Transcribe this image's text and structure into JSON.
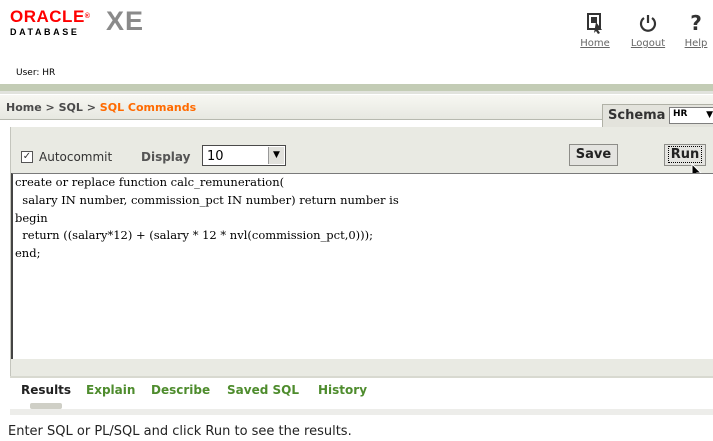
{
  "header": {
    "logo_oracle": "ORACLE",
    "logo_database": "DATABASE",
    "logo_xe": "XE",
    "nav": [
      {
        "label": "Home",
        "icon": "home-icon"
      },
      {
        "label": "Logout",
        "icon": "power-icon"
      },
      {
        "label": "Help",
        "icon": "help-icon"
      }
    ],
    "user": "User: HR"
  },
  "breadcrumb": {
    "home": "Home",
    "sep": ">",
    "sql": "SQL",
    "current": "SQL Commands"
  },
  "schema": {
    "label": "Schema",
    "value": "HR"
  },
  "toolbar": {
    "autocommit_label": "Autocommit",
    "autocommit_checked": true,
    "display_label": "Display",
    "display_value": "10",
    "save_label": "Save",
    "run_label": "Run"
  },
  "editor": {
    "sql": "create or replace function calc_remuneration(\n  salary IN number, commission_pct IN number) return number is\nbegin\n  return ((salary*12) + (salary * 12 * nvl(commission_pct,0)));\nend;"
  },
  "tabs": [
    {
      "label": "Results",
      "active": true
    },
    {
      "label": "Explain",
      "active": false
    },
    {
      "label": "Describe",
      "active": false
    },
    {
      "label": "Saved SQL",
      "active": false
    },
    {
      "label": "History",
      "active": false
    }
  ],
  "results": {
    "message": "Enter SQL or PL/SQL and click Run to see the results."
  },
  "colors": {
    "oracle_red": "#ff0000",
    "crumb_orange": "#ff6a00",
    "tab_green": "#4e8c2d"
  }
}
